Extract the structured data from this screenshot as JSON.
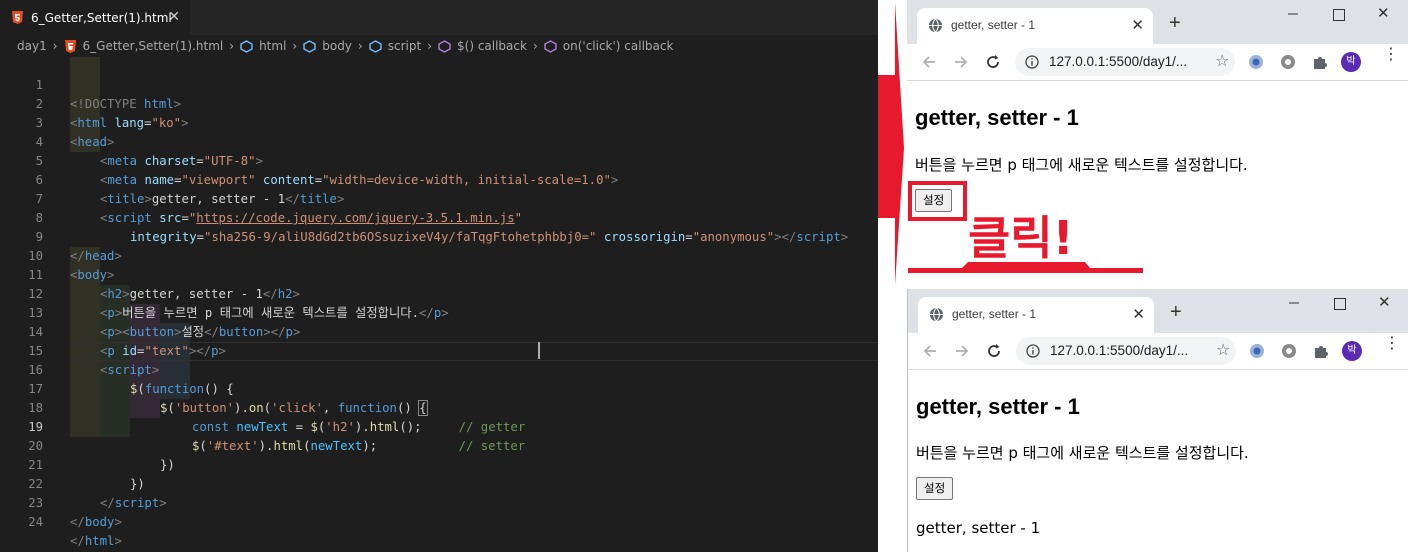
{
  "editor": {
    "tab_label": "6_Getter,Setter(1).html",
    "breadcrumb": [
      "day1",
      "6_Getter,Setter(1).html",
      "html",
      "body",
      "script",
      "$() callback",
      "on('click') callback"
    ],
    "line_numbers": [
      "1",
      "2",
      "3",
      "4",
      "5",
      "6",
      "7",
      "8",
      "9",
      "10",
      "11",
      "12",
      "13",
      "14",
      "15",
      "16",
      "17",
      "18",
      "19",
      "20",
      "21",
      "22",
      "23",
      "24"
    ],
    "active_line": "19",
    "code": {
      "l1": [
        "<!DOCTYPE ",
        "html",
        ">"
      ],
      "l2": [
        "<",
        "html",
        " ",
        "lang",
        "=",
        "\"ko\"",
        ">"
      ],
      "l3": [
        "<",
        "head",
        ">"
      ],
      "l4": [
        "<",
        "meta",
        " ",
        "charset",
        "=",
        "\"UTF-8\"",
        ">"
      ],
      "l5": [
        "<",
        "meta",
        " ",
        "name",
        "=",
        "\"viewport\"",
        " ",
        "content",
        "=",
        "\"width=device-width, initial-scale=1.0\"",
        ">"
      ],
      "l6": [
        "<",
        "title",
        ">",
        "getter, setter - 1",
        "</",
        "title",
        ">"
      ],
      "l7": [
        "<",
        "script",
        " ",
        "src",
        "=",
        "\"",
        "https://code.jquery.com/jquery-3.5.1.min.js",
        "\""
      ],
      "l8": [
        "integrity",
        "=",
        "\"sha256-9/aliU8dGd2tb6OSsuzixeV4y/faTqgFtohetphbbj0=\"",
        " ",
        "crossorigin",
        "=",
        "\"anonymous\"",
        "></",
        "script",
        ">"
      ],
      "l9": [
        "</",
        "head",
        ">"
      ],
      "l10": [
        "<",
        "body",
        ">"
      ],
      "l11": [
        "<",
        "h2",
        ">",
        "getter, setter - 1",
        "</",
        "h2",
        ">"
      ],
      "l12": [
        "<",
        "p",
        ">",
        "버튼을 누르면 p 태그에 새로운 텍스트를 설정합니다.",
        "</",
        "p",
        ">"
      ],
      "l13": [
        "<",
        "p",
        "><",
        "button",
        ">",
        "설정",
        "</",
        "button",
        "></",
        "p",
        ">"
      ],
      "l14": [
        "<",
        "p",
        " ",
        "id",
        "=",
        "\"text\"",
        "></",
        "p",
        ">"
      ],
      "l15": [
        "<",
        "script",
        ">"
      ],
      "l16": [
        "$",
        "(",
        "function",
        "() {"
      ],
      "l17": [
        "$",
        "(",
        "'button'",
        ").",
        "on",
        "(",
        "'click'",
        ", ",
        "function",
        "() ",
        "{"
      ],
      "l18": [
        "const ",
        "newText",
        " = ",
        "$",
        "(",
        "'h2'",
        ").",
        "html",
        "();",
        "     ",
        "// getter"
      ],
      "l19": [
        "$",
        "(",
        "'#text'",
        ").",
        "html",
        "(",
        "newText",
        ");",
        "           ",
        "// setter"
      ],
      "l20": [
        "})"
      ],
      "l21": [
        "})"
      ],
      "l22": [
        "</",
        "script",
        ">"
      ],
      "l23": [
        "</",
        "body",
        ">"
      ],
      "l24": [
        "</",
        "html",
        ">"
      ]
    }
  },
  "browser_before": {
    "tab_title": "getter, setter - 1",
    "url": "127.0.0.1:5500/day1/...",
    "avatar_letter": "박",
    "heading": "getter, setter - 1",
    "paragraph": "버튼을 누르면 p 태그에 새로운 텍스트를 설정합니다.",
    "button_label": "설정"
  },
  "annotation": {
    "click_label": "클릭!",
    "color": "#e8192c"
  },
  "browser_after": {
    "tab_title": "getter, setter - 1",
    "url": "127.0.0.1:5500/day1/...",
    "avatar_letter": "박",
    "heading": "getter, setter - 1",
    "paragraph": "버튼을 누르면 p 태그에 새로운 텍스트를 설정합니다.",
    "button_label": "설정",
    "result_text": "getter, setter - 1"
  },
  "icons": {
    "file": "html5-icon",
    "breadcrumb_symbol": "symbol-icon",
    "tab_favicon": "globe-icon",
    "extensions": [
      "ext-blue-icon",
      "ext-gear-icon",
      "puzzle-icon"
    ]
  }
}
